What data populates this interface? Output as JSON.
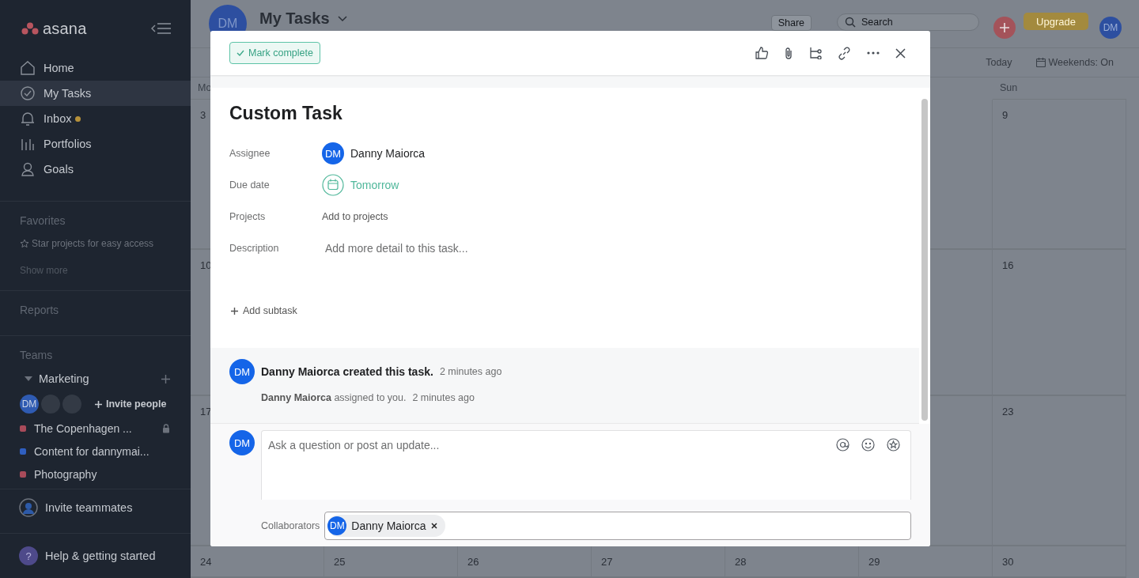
{
  "sidebar": {
    "logo": "asana",
    "nav": [
      {
        "label": "Home",
        "selected": false,
        "unread": false
      },
      {
        "label": "My Tasks",
        "selected": true,
        "unread": false
      },
      {
        "label": "Inbox",
        "selected": false,
        "unread": true
      },
      {
        "label": "Portfolios",
        "selected": false,
        "unread": false
      },
      {
        "label": "Goals",
        "selected": false,
        "unread": false
      }
    ],
    "favorites": {
      "heading": "Favorites",
      "hint": "Star projects for easy access",
      "more": "Show more"
    },
    "reports": "Reports",
    "teams": {
      "heading": "Teams",
      "team": {
        "name": "Marketing",
        "expanded": true,
        "members": [
          {
            "kind": "initials",
            "initials": "DM"
          },
          {
            "kind": "blank"
          },
          {
            "kind": "blank"
          }
        ],
        "invite": "Invite people",
        "projects": [
          {
            "name": "The Copenhagen ...",
            "color": "#a84b5a",
            "private": true
          },
          {
            "name": "Content for dannymai...",
            "color": "#2f5fc0",
            "private": false
          },
          {
            "name": "Photography",
            "color": "#a84b5a",
            "private": false
          }
        ]
      }
    },
    "invite_teammates": "Invite teammates",
    "help_badge": "?",
    "help": "Help & getting started"
  },
  "header": {
    "avatar": "DM",
    "title": "My Tasks",
    "share": "Share",
    "search_placeholder": "Search",
    "upgrade": "Upgrade",
    "user": "DM"
  },
  "toolbar": {
    "today": "Today",
    "weekends": "Weekends: On"
  },
  "calendar": {
    "weekday_first": "Mo",
    "weekday_last": "Sun",
    "weeks": [
      {
        "first": "3",
        "last": "9"
      },
      {
        "first": "10",
        "last": "16"
      },
      {
        "first": "17",
        "last": "23"
      },
      {
        "days": [
          "24",
          "25",
          "26",
          "27",
          "28",
          "29",
          "30"
        ]
      }
    ]
  },
  "modal": {
    "mark_complete": "Mark complete",
    "title": "Custom Task",
    "fields": [
      {
        "kind": "person",
        "label": "Assignee",
        "initials": "DM",
        "value": "Danny Maiorca"
      },
      {
        "kind": "date",
        "label": "Due date",
        "value": "Tomorrow"
      },
      {
        "kind": "link",
        "label": "Projects",
        "value": "Add to projects"
      },
      {
        "kind": "text",
        "label": "Description",
        "placeholder": "Add more detail to this task..."
      }
    ],
    "add_subtask": "Add subtask",
    "activity": [
      {
        "kind": "story",
        "initials": "DM",
        "text": "Danny Maiorca created this task.",
        "time": "2 minutes ago"
      },
      {
        "kind": "minor",
        "text": "**Danny Maiorca** assigned to you.",
        "time": "2 minutes ago"
      }
    ],
    "comment": {
      "initials": "DM",
      "placeholder": "Ask a question or post an update..."
    },
    "collaborators": {
      "label": "Collaborators",
      "people": [
        {
          "initials": "DM",
          "name": "Danny Maiorca"
        }
      ]
    }
  }
}
